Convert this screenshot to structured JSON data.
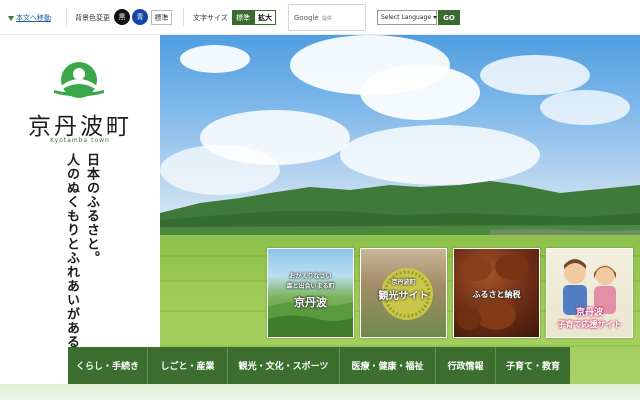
{
  "topbar": {
    "skip_link": "本文へ移動",
    "bg_color_label": "背景色変更",
    "bg_black": "黒",
    "bg_blue": "青",
    "bg_standard": "標準",
    "font_size_label": "文字サイズ",
    "font_standard": "標準",
    "font_large": "拡大",
    "search_brand": "Google",
    "search_sub": "提供",
    "language_select": "Select Language",
    "go_button": "GO"
  },
  "logo": {
    "town_name": "京丹波町",
    "town_roman": "Kyotamba town",
    "tagline_line1": "日本のふるさと。",
    "tagline_line2": "人のぬくもりとふれあいがあるまち",
    "brand_green": "#3aa84a"
  },
  "hero_cards": [
    {
      "line1": "おかえりなさい",
      "line2": "森と出会いまる町",
      "title": "京丹波"
    },
    {
      "line1": "京丹波町",
      "title": "観光サイト"
    },
    {
      "title": "ふるさと納税"
    },
    {
      "title": "京丹波",
      "subtitle": "子育て応援サイト"
    }
  ],
  "slider": {
    "dot_count": 5,
    "pause_icon": "pause-icon"
  },
  "main_nav": [
    {
      "label": "くらし・手続き"
    },
    {
      "label": "しごと・産業"
    },
    {
      "label": "観光・文化・スポーツ"
    },
    {
      "label": "医療・健康・福祉"
    },
    {
      "label": "行政情報"
    },
    {
      "label": "子育て・教育"
    }
  ],
  "colors": {
    "nav_green": "#3b6e2f",
    "accent_green": "#3a6b2e"
  }
}
